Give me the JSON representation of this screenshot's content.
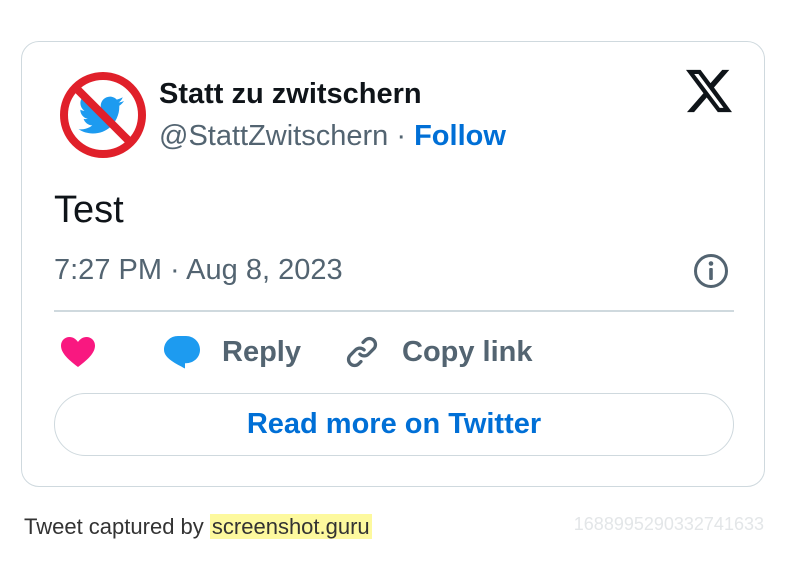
{
  "tweet": {
    "display_name": "Statt zu zwitschern",
    "handle": "@StattZwitschern",
    "separator": "·",
    "follow_label": "Follow",
    "text": "Test",
    "timestamp": "7:27 PM · Aug 8, 2023",
    "avatar_icon": "no-twitter-bird-icon",
    "brand_icon": "x-logo-icon"
  },
  "actions": {
    "like_icon": "heart-icon",
    "reply_label": "Reply",
    "copy_link_label": "Copy link",
    "read_more_label": "Read more on Twitter"
  },
  "footer": {
    "captured_prefix": "Tweet captured by",
    "captured_site": "screenshot.guru",
    "tweet_id": "1688995290332741633"
  },
  "colors": {
    "link_blue": "#006fd6",
    "like_pink": "#f91880",
    "reply_blue": "#1d9bf0",
    "muted_text": "#536471",
    "border": "#cfd9de",
    "highlight": "#fdf99e"
  }
}
